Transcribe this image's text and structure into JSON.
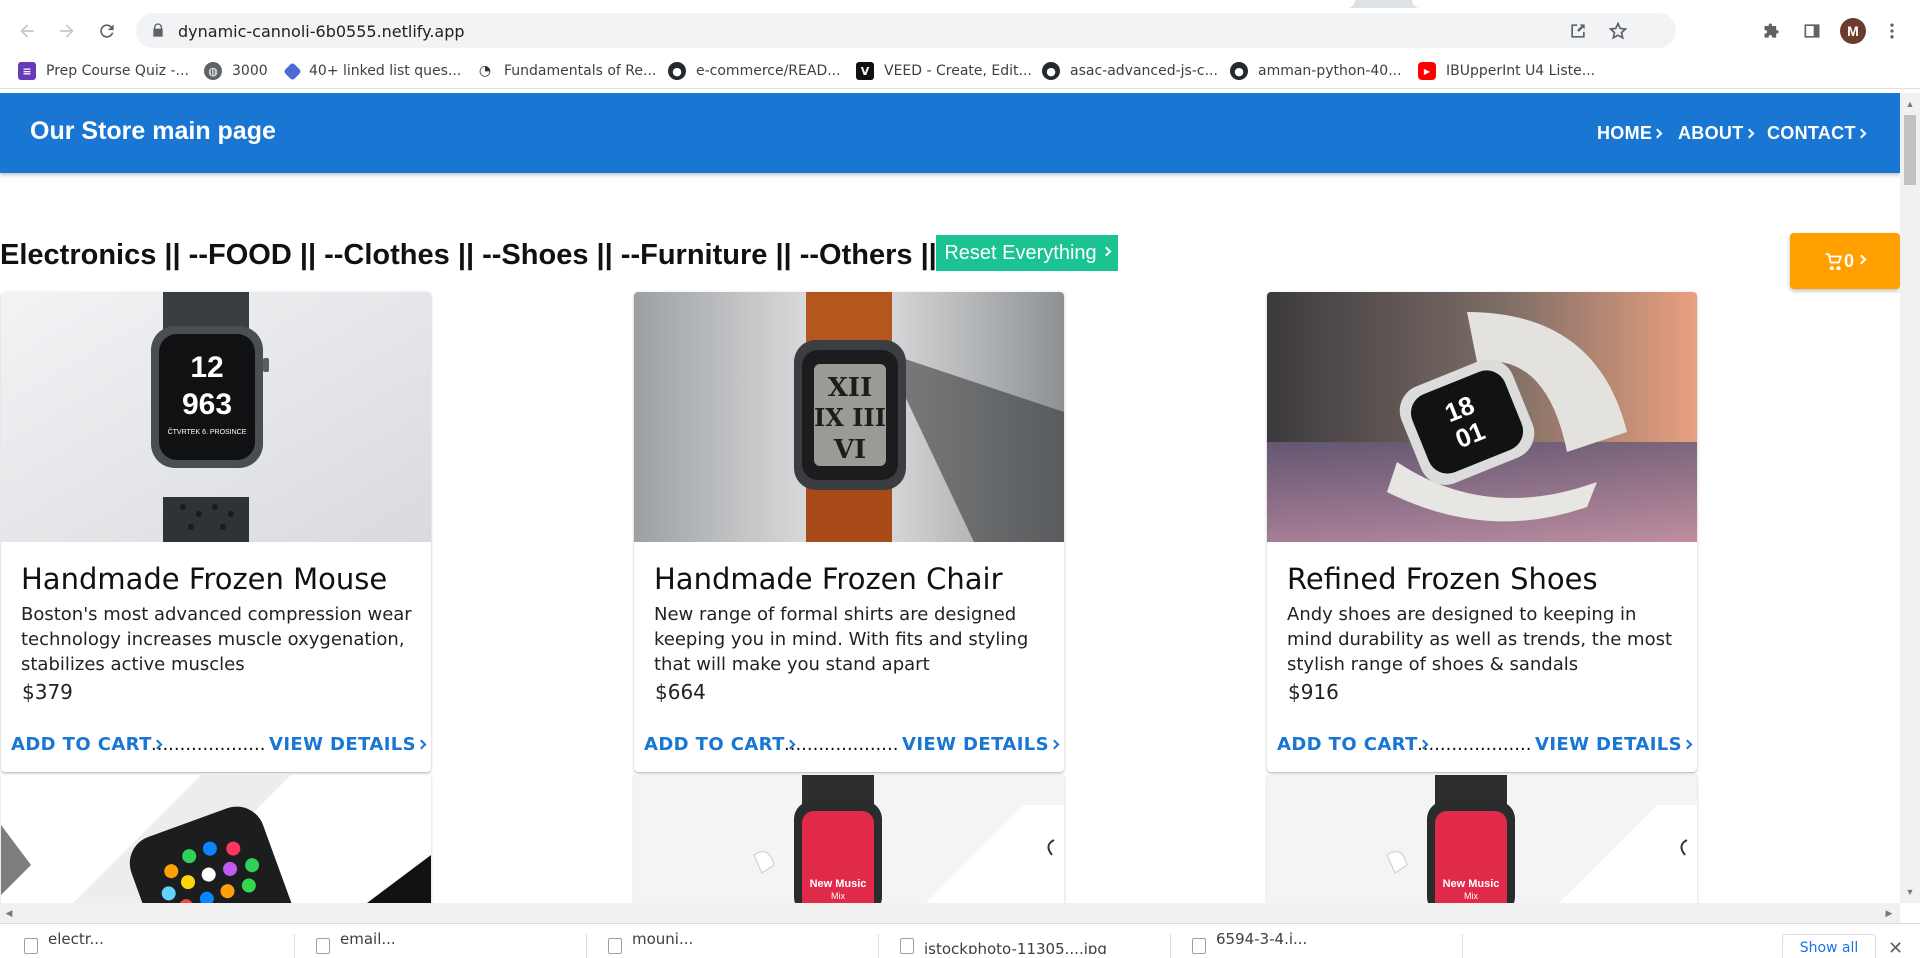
{
  "browser": {
    "url": "dynamic-cannoli-6b0555.netlify.app",
    "avatar_letter": "M",
    "bookmarks": [
      {
        "label": "Prep Course Quiz -...",
        "icon": "form-icon",
        "color": "#673ab7"
      },
      {
        "label": "3000",
        "icon": "globe-icon",
        "color": "#5f6368"
      },
      {
        "label": "40+ linked list ques...",
        "icon": "diamond-icon",
        "color": "#4b6bd6"
      },
      {
        "label": "Fundamentals of Re...",
        "icon": "glasses-icon",
        "color": "#333333"
      },
      {
        "label": "e-commerce/READ...",
        "icon": "github-icon",
        "color": "#24292e"
      },
      {
        "label": "VEED - Create, Edit...",
        "icon": "veed-icon",
        "color": "#111111"
      },
      {
        "label": "asac-advanced-js-c...",
        "icon": "github-icon",
        "color": "#24292e"
      },
      {
        "label": "amman-python-40...",
        "icon": "github-icon",
        "color": "#24292e"
      },
      {
        "label": "IBUpperInt U4 Liste...",
        "icon": "youtube-icon",
        "color": "#ff0000"
      }
    ]
  },
  "appbar": {
    "title": "Our Store main page",
    "nav": [
      "HOME",
      "ABOUT",
      "CONTACT"
    ],
    "color": "#1976d2"
  },
  "categories": {
    "text": "Electronics || --FOOD || --Clothes || --Shoes || --Furniture || --Others || --",
    "reset_label": "Reset Everything",
    "reset_color": "#1bc392"
  },
  "cart": {
    "count": "0",
    "color": "#ffa000"
  },
  "products": [
    {
      "title": "Handmade Frozen Mouse",
      "description": "Boston's most advanced compression wear technology increases muscle oxygenation, stabilizes active muscles",
      "price": "$379",
      "add_label": "ADD TO CART",
      "dots": "....................",
      "view_label": "VIEW DETAILS"
    },
    {
      "title": "Handmade Frozen Chair",
      "description": "New range of formal shirts are designed keeping you in mind. With fits and styling that will make you stand apart",
      "price": "$664",
      "add_label": "ADD TO CART",
      "dots": "....................",
      "view_label": "VIEW DETAILS"
    },
    {
      "title": "Refined Frozen Shoes",
      "description": "Andy shoes are designed to keeping in mind durability as well as trends, the most stylish range of shoes & sandals",
      "price": "$916",
      "add_label": "ADD TO CART",
      "dots": "....................",
      "view_label": "VIEW DETAILS"
    }
  ],
  "downloads": [
    {
      "name": "electr..."
    },
    {
      "name": "email..."
    },
    {
      "name": "mouni..."
    },
    {
      "name": "istockphoto-11305....jpg"
    },
    {
      "name": "6594-3-4.i..."
    }
  ],
  "show_all_label": "Show all"
}
